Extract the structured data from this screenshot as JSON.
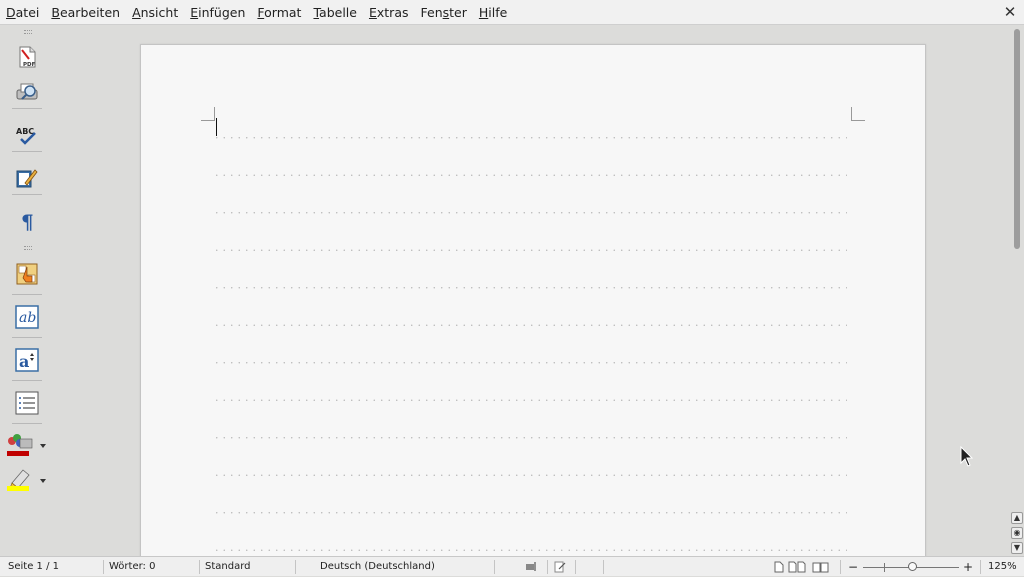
{
  "menubar": {
    "items": [
      {
        "mnemonic": "D",
        "rest": "atei"
      },
      {
        "mnemonic": "B",
        "rest": "earbeiten"
      },
      {
        "mnemonic": "A",
        "rest": "nsicht"
      },
      {
        "mnemonic": "E",
        "rest": "infügen"
      },
      {
        "mnemonic": "F",
        "rest": "ormat"
      },
      {
        "mnemonic": "T",
        "rest": "abelle"
      },
      {
        "mnemonic": "E",
        "rest": "xtras"
      },
      {
        "pre": "Fen",
        "mnemonic": "s",
        "rest": "ter"
      },
      {
        "mnemonic": "H",
        "rest": "ilfe"
      }
    ],
    "close_glyph": "✕"
  },
  "toolbar": {
    "buttons": [
      {
        "name": "pdf-export",
        "icon": "pdf-icon",
        "label": "PDF"
      },
      {
        "name": "print-preview",
        "icon": "print-preview-icon"
      },
      {
        "name": "spellcheck",
        "icon": "spellcheck-icon",
        "label": "ABC"
      },
      {
        "name": "edit-mode",
        "icon": "edit-pen-icon"
      },
      {
        "name": "formatting-marks",
        "icon": "pilcrow-icon",
        "label": "¶"
      },
      {
        "name": "navigator",
        "icon": "navigator-icon"
      },
      {
        "name": "styles",
        "icon": "styles-icon",
        "label": "ab"
      },
      {
        "name": "font-size",
        "icon": "font-size-icon",
        "label": "a"
      },
      {
        "name": "numbering",
        "icon": "numbering-list-icon"
      },
      {
        "name": "font-color",
        "icon": "font-color-icon"
      },
      {
        "name": "highlight",
        "icon": "highlighter-icon"
      }
    ]
  },
  "status": {
    "page": "Seite 1 / 1",
    "words": "Wörter: 0",
    "style": "Standard",
    "language": "Deutsch (Deutschland)",
    "zoom": "125%",
    "zoom_minus": "−",
    "zoom_plus": "+"
  },
  "scroll": {
    "prev_glyph": "▲",
    "nav_glyph": "◉",
    "next_glyph": "▼"
  },
  "colors": {
    "font_color_bar": "#c00000",
    "highlight_bar": "#ffff00"
  }
}
